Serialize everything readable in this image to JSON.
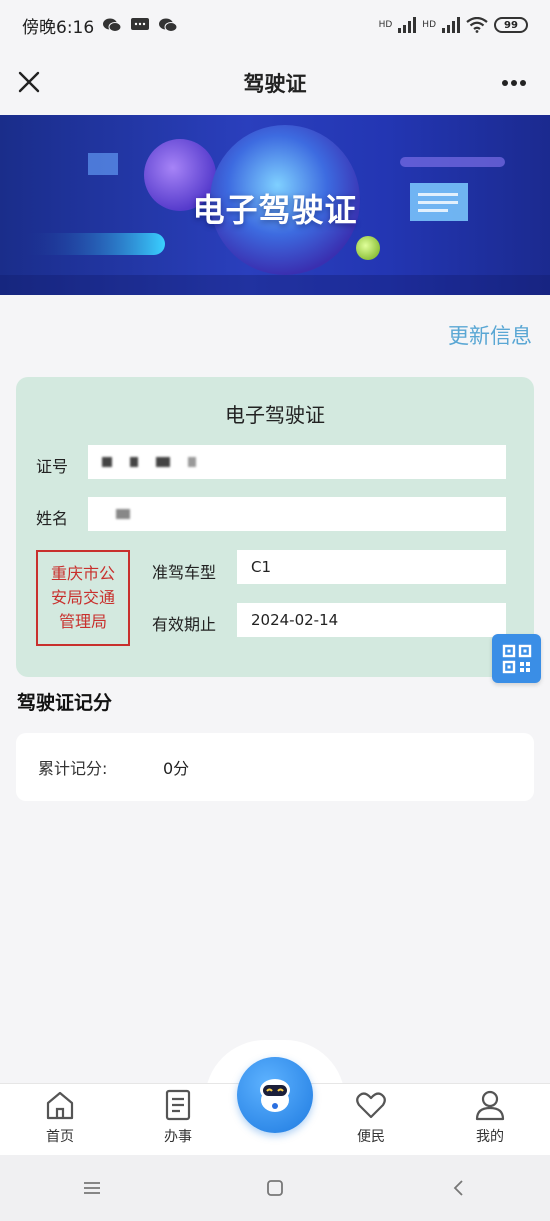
{
  "status_bar": {
    "time": "傍晚6:16",
    "battery": "99",
    "network_1": "HD",
    "network_2": "HD",
    "icons": [
      "wechat-icon",
      "message-icon",
      "wechat-icon",
      "signal-icon",
      "signal-icon",
      "wifi-icon",
      "battery-icon"
    ]
  },
  "header": {
    "title": "驾驶证"
  },
  "banner": {
    "title": "电子驾驶证"
  },
  "update_info_label": "更新信息",
  "license": {
    "title": "电子驾驶证",
    "id_label": "证号",
    "name_label": "姓名",
    "stamp_lines": [
      "重庆市公",
      "安局交通",
      "管理局"
    ],
    "class_label": "准驾车型",
    "class_value": "C1",
    "expiry_label": "有效期止",
    "expiry_value": "2024-02-14"
  },
  "points": {
    "section_title": "驾驶证记分",
    "label": "累计记分:",
    "value": "0分"
  },
  "tab_bar": {
    "items": [
      {
        "label": "首页",
        "icon": "home-icon"
      },
      {
        "label": "办事",
        "icon": "document-icon"
      },
      {
        "label": "",
        "icon": "robot-assistant-icon"
      },
      {
        "label": "便民",
        "icon": "heart-icon"
      },
      {
        "label": "我的",
        "icon": "user-icon"
      }
    ]
  },
  "colors": {
    "accent": "#3a8ee6",
    "link": "#5aa7d4",
    "card_bg": "#d3e9df",
    "stamp_red": "#c8302d",
    "banner_blue": "#2a3fbd"
  }
}
